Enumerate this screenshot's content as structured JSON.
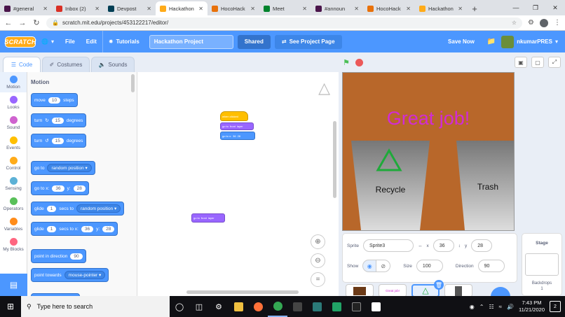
{
  "browser": {
    "tabs": [
      {
        "title": "#general",
        "color": "#4a154b",
        "active": false
      },
      {
        "title": "Inbox (2)",
        "color": "#d93025",
        "active": false
      },
      {
        "title": "Devpost",
        "color": "#003e54",
        "active": false
      },
      {
        "title": "Hackathon",
        "color": "#ffab19",
        "active": true
      },
      {
        "title": "HocoHack",
        "color": "#e8710a",
        "active": false
      },
      {
        "title": "Meet",
        "color": "#00832d",
        "active": false
      },
      {
        "title": "#announ",
        "color": "#4a154b",
        "active": false
      },
      {
        "title": "HocoHack",
        "color": "#e8710a",
        "active": false
      },
      {
        "title": "Hackathon",
        "color": "#ffab19",
        "active": false
      }
    ],
    "new_tab": "+",
    "url": "scratch.mit.edu/projects/453122217/editor/"
  },
  "menubar": {
    "logo": "SCRATCH",
    "file": "File",
    "edit": "Edit",
    "tutorials": "Tutorials",
    "project_title": "Hackathon Project",
    "shared": "Shared",
    "see_project": "See Project Page",
    "save_now": "Save Now",
    "username": "nkumarPRES"
  },
  "editor_tabs": {
    "code": "Code",
    "costumes": "Costumes",
    "sounds": "Sounds"
  },
  "categories": [
    {
      "label": "Motion",
      "color": "#4c97ff"
    },
    {
      "label": "Looks",
      "color": "#9966ff"
    },
    {
      "label": "Sound",
      "color": "#cf63cf"
    },
    {
      "label": "Events",
      "color": "#ffbf00"
    },
    {
      "label": "Control",
      "color": "#ffab19"
    },
    {
      "label": "Sensing",
      "color": "#5cb1d6"
    },
    {
      "label": "Operators",
      "color": "#59c059"
    },
    {
      "label": "Variables",
      "color": "#ff8c1a"
    },
    {
      "label": "My Blocks",
      "color": "#ff6680"
    }
  ],
  "palette": {
    "title": "Motion",
    "move": {
      "pre": "move",
      "val": "10",
      "post": "steps"
    },
    "turn_right": {
      "pre": "turn",
      "val": "15",
      "post": "degrees"
    },
    "turn_left": {
      "pre": "turn",
      "val": "15",
      "post": "degrees"
    },
    "goto": {
      "pre": "go to",
      "dd": "random position"
    },
    "goto_xy": {
      "pre": "go to x:",
      "x": "36",
      "ylabel": "y:",
      "y": "28"
    },
    "glide": {
      "pre": "glide",
      "val": "1",
      "mid": "secs to",
      "dd": "random position"
    },
    "glide_xy": {
      "pre": "glide",
      "val": "1",
      "mid": "secs to x:",
      "x": "36",
      "ylabel": "y:",
      "y": "28"
    },
    "point_dir": {
      "pre": "point in direction",
      "val": "90"
    },
    "point_towards": {
      "pre": "point towards",
      "dd": "mouse-pointer"
    }
  },
  "script": {
    "hat": "when clicked",
    "go_front": {
      "pre": "go to",
      "dd": "front",
      "post": "layer"
    },
    "goto_xy": {
      "pre": "go to x:",
      "x": "36",
      "y": "28"
    },
    "loose": {
      "pre": "go to",
      "dd": "front",
      "post": "layer"
    }
  },
  "stage": {
    "title": "Great job!",
    "bin1": "Recycle",
    "bin2": "Trash"
  },
  "sprite_info": {
    "sprite_label": "Sprite",
    "sprite_name": "Sprite3",
    "x_label": "x",
    "x": "36",
    "y_label": "y",
    "y": "28",
    "show_label": "Show",
    "size_label": "Size",
    "size": "100",
    "direction_label": "Direction",
    "direction": "90"
  },
  "sprite_thumbs": {
    "great_job": "Great job!"
  },
  "stage_panel": {
    "title": "Stage",
    "backdrops_label": "Backdrops",
    "backdrops_count": "1"
  },
  "taskbar": {
    "search_placeholder": "Type here to search",
    "time": "7:43 PM",
    "date": "11/21/2020",
    "notif_count": "2"
  }
}
